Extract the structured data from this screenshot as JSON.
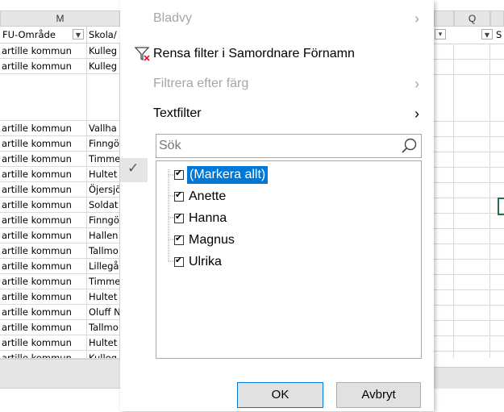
{
  "columns": {
    "m": "M",
    "q": "Q"
  },
  "filter_headers": {
    "fu_omrade": "FU-Område",
    "skola": "Skola/"
  },
  "filter_button_glyph": "▼",
  "filter_active_glyph": "▾",
  "rows": [
    {
      "a": "artille kommun",
      "b": "Kulleg"
    },
    {
      "a": "artille kommun",
      "b": "Kulleg"
    },
    {
      "a": "",
      "b": ""
    },
    {
      "a": "artille kommun",
      "b": "Vallha"
    },
    {
      "a": "artille kommun",
      "b": "Finngö"
    },
    {
      "a": "artille kommun",
      "b": "Timme"
    },
    {
      "a": "artille kommun",
      "b": "Hultet"
    },
    {
      "a": "artille kommun",
      "b": "Öjersjö"
    },
    {
      "a": "artille kommun",
      "b": "Soldat"
    },
    {
      "a": "artille kommun",
      "b": "Finngö"
    },
    {
      "a": "artille kommun",
      "b": "Hallen"
    },
    {
      "a": "artille kommun",
      "b": "Tallmo"
    },
    {
      "a": "artille kommun",
      "b": "Lillegå"
    },
    {
      "a": "artille kommun",
      "b": "Timme"
    },
    {
      "a": "artille kommun",
      "b": "Hultet"
    },
    {
      "a": "artille kommun",
      "b": "Oluff N"
    },
    {
      "a": "artille kommun",
      "b": "Tallmo"
    },
    {
      "a": "artille kommun",
      "b": "Hultet"
    },
    {
      "a": "artille kommun",
      "b": "Kulleg"
    }
  ],
  "menu": {
    "bladvy": "Bladvy",
    "rensa_filter": "Rensa filter i Samordnare Förnamn",
    "filtrera_farg": "Filtrera efter färg",
    "textfilter": "Textfilter",
    "arrow": "›",
    "search_placeholder": "Sök",
    "items": [
      "(Markera allt)",
      "Anette",
      "Hanna",
      "Magnus",
      "Ulrika"
    ],
    "ok": "OK",
    "avbryt": "Avbryt"
  },
  "colors": {
    "selection": "#0078d7",
    "clear_filter_x": "#e81123"
  }
}
